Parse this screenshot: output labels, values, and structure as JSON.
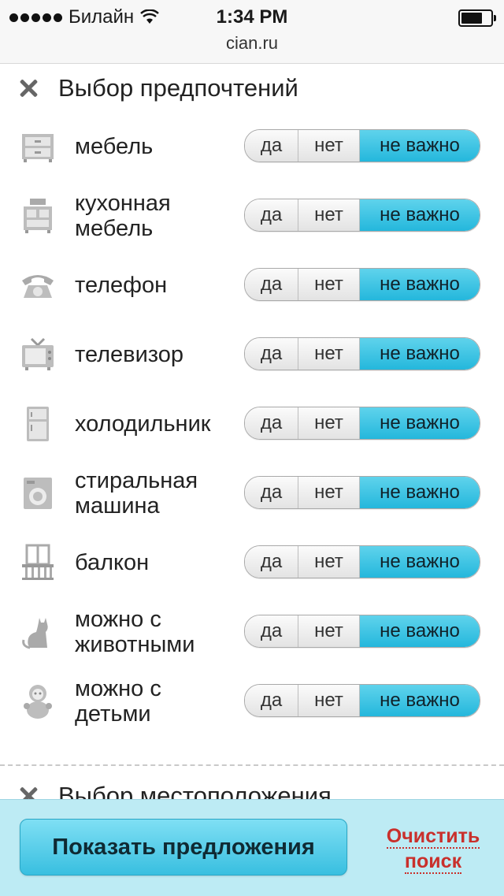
{
  "status_bar": {
    "carrier": "Билайн",
    "time": "1:34 PM",
    "url": "cian.ru"
  },
  "section": {
    "title": "Выбор предпочтений"
  },
  "options": [
    "да",
    "нет",
    "не важно"
  ],
  "selected_option": "не важно",
  "rows": [
    {
      "label": "мебель",
      "icon": "dresser-icon"
    },
    {
      "label": "кухонная мебель",
      "icon": "kitchen-furniture-icon"
    },
    {
      "label": "телефон",
      "icon": "phone-icon"
    },
    {
      "label": "телевизор",
      "icon": "tv-icon"
    },
    {
      "label": "холодильник",
      "icon": "fridge-icon"
    },
    {
      "label": "стиральная машина",
      "icon": "washing-machine-icon"
    },
    {
      "label": "балкон",
      "icon": "balcony-icon"
    },
    {
      "label": "можно с животными",
      "icon": "cat-icon"
    },
    {
      "label": "можно с детьми",
      "icon": "child-icon"
    }
  ],
  "next_section": {
    "title": "Выбор местоположения"
  },
  "footer": {
    "show_button": "Показать предложения",
    "clear_link": "Очистить поиск"
  },
  "colors": {
    "accent": "#38bfe0",
    "active_segment": "#24b7dc",
    "footer_bg": "#bdebf4",
    "clear_link": "#c9302c"
  }
}
